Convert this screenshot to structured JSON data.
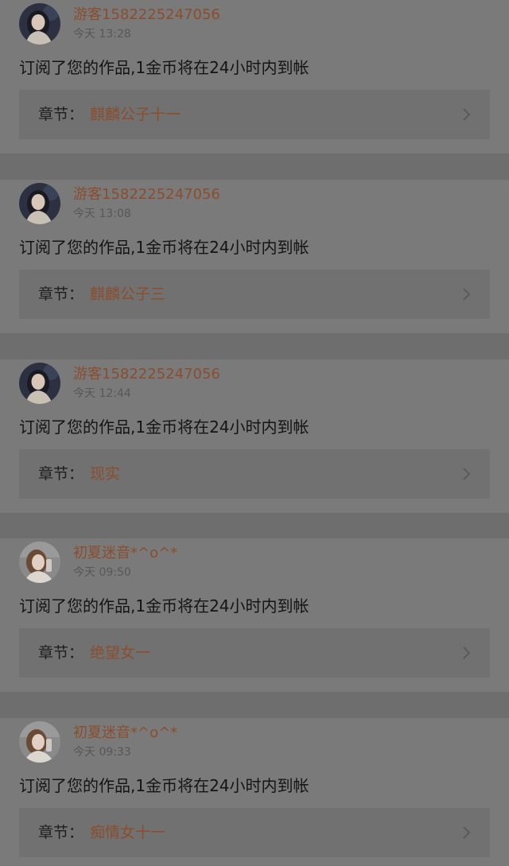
{
  "feed": {
    "items": [
      {
        "username": "游客1582225247056",
        "time": "今天 13:28",
        "message": "订阅了您的作品,1金币将在24小时内到帐",
        "chapter_label": "章节：",
        "chapter_name": "麒麟公子十一",
        "avatar_icon": "avatar-dark-hair-girl"
      },
      {
        "username": "游客1582225247056",
        "time": "今天 13:08",
        "message": "订阅了您的作品,1金币将在24小时内到帐",
        "chapter_label": "章节：",
        "chapter_name": "麒麟公子三",
        "avatar_icon": "avatar-dark-hair-girl"
      },
      {
        "username": "游客1582225247056",
        "time": "今天 12:44",
        "message": "订阅了您的作品,1金币将在24小时内到帐",
        "chapter_label": "章节：",
        "chapter_name": "现实",
        "avatar_icon": "avatar-dark-hair-girl"
      },
      {
        "username": "初夏迷音*^o^*",
        "time": "今天 09:50",
        "message": "订阅了您的作品,1金币将在24小时内到帐",
        "chapter_label": "章节：",
        "chapter_name": "绝望女一",
        "avatar_icon": "avatar-light-girl"
      },
      {
        "username": "初夏迷音*^o^*",
        "time": "今天 09:33",
        "message": "订阅了您的作品,1金币将在24小时内到帐",
        "chapter_label": "章节：",
        "chapter_name": "痴情女十一",
        "avatar_icon": "avatar-light-girl"
      }
    ]
  },
  "colors": {
    "accent": "#8b4d2e",
    "page_bg": "#6e6e6e",
    "card_bg": "#7a7a7a",
    "chapter_bg": "#717171"
  }
}
